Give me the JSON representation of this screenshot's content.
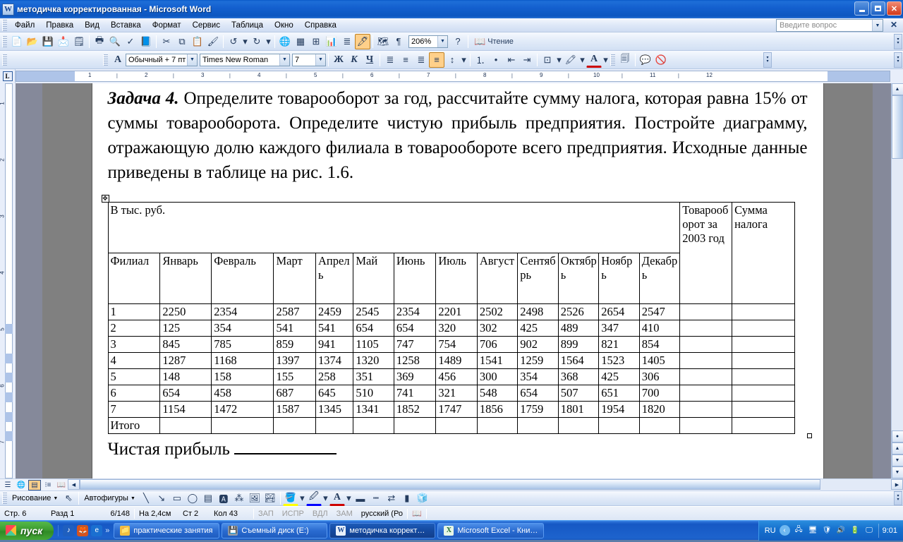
{
  "window": {
    "title": "методичка корректированная - Microsoft Word",
    "app_icon": "word-icon",
    "minimize": "minimize-icon",
    "maximize": "maximize-icon",
    "close": "✕"
  },
  "menu": {
    "items": [
      "Файл",
      "Правка",
      "Вид",
      "Вставка",
      "Формат",
      "Сервис",
      "Таблица",
      "Окно",
      "Справка"
    ]
  },
  "ask_box": {
    "placeholder": "Введите вопрос",
    "close": "✕"
  },
  "standard_toolbar": {
    "zoom_value": "206%",
    "reading_label": "Чтение",
    "buttons": [
      "new-document-icon",
      "open-folder-icon",
      "save-icon",
      "mail-icon",
      "permission-icon",
      "print-icon",
      "print-preview-icon",
      "spellcheck-icon",
      "research-icon",
      "cut-icon",
      "copy-icon",
      "paste-icon",
      "format-painter-icon",
      "undo-icon",
      "redo-icon",
      "insert-hyperlink-icon",
      "insert-table-icon",
      "tables-borders-icon",
      "insert-excel-sheet-icon",
      "columns-icon",
      "drawing-icon",
      "document-map-icon",
      "show-formatting-icon",
      "help-icon"
    ]
  },
  "formatting_toolbar": {
    "style": "Обычный + 7 пт",
    "font": "Times New Roman",
    "size": "7",
    "bold": "Ж",
    "italic": "К",
    "underline": "Ч",
    "buttons": [
      "styles-icon",
      "align-left-icon",
      "align-center-icon",
      "align-right-icon",
      "align-justify-icon",
      "line-spacing-icon",
      "numbered-list-icon",
      "bulleted-list-icon",
      "decrease-indent-icon",
      "increase-indent-icon",
      "borders-icon",
      "highlight-icon",
      "font-color-icon"
    ]
  },
  "ruler": {
    "tab_selector": "L",
    "h_numbers": [
      "1",
      "2",
      "3",
      "4",
      "5",
      "6",
      "7",
      "8",
      "9",
      "10",
      "11",
      "12"
    ],
    "v_numbers": [
      "1",
      "2",
      "3",
      "4",
      "5",
      "6",
      "7"
    ]
  },
  "document": {
    "paragraph": {
      "lead_bold": "Задача 4.",
      "text": " Определите товарооборот за год, рассчитайте сумму налога, которая равна 15% от суммы товарооборота. Определите чистую прибыль предприятия. Постройте диаграмму, отражающую долю каждого филиала в товарообороте всего предприятия. Исходные данные приведены в таблице на рис. 1.6."
    },
    "table": {
      "caption": "В тыс. руб.",
      "headers": [
        "Филиал",
        "Январь",
        "Февраль",
        "Март",
        "Апрель",
        "Май",
        "Июнь",
        "Июль",
        "Август",
        "Сентябрь",
        "Октябрь",
        "Ноябрь",
        "Декабрь"
      ],
      "summary_headers": [
        "Товарооборот за 2003 год",
        "Сумма налога"
      ],
      "rows": [
        {
          "branch": "1",
          "values": [
            "2250",
            "2354",
            "2587",
            "2459",
            "2545",
            "2354",
            "2201",
            "2502",
            "2498",
            "2526",
            "2654",
            "2547"
          ],
          "turnover": "",
          "tax": ""
        },
        {
          "branch": "2",
          "values": [
            "125",
            "354",
            "541",
            "541",
            "654",
            "654",
            "320",
            "302",
            "425",
            "489",
            "347",
            "410"
          ],
          "turnover": "",
          "tax": ""
        },
        {
          "branch": "3",
          "values": [
            "845",
            "785",
            "859",
            "941",
            "1105",
            "747",
            "754",
            "706",
            "902",
            "899",
            "821",
            "854"
          ],
          "turnover": "",
          "tax": ""
        },
        {
          "branch": "4",
          "values": [
            "1287",
            "1168",
            "1397",
            "1374",
            "1320",
            "1258",
            "1489",
            "1541",
            "1259",
            "1564",
            "1523",
            "1405"
          ],
          "turnover": "",
          "tax": ""
        },
        {
          "branch": "5",
          "values": [
            "148",
            "158",
            "155",
            "258",
            "351",
            "369",
            "456",
            "300",
            "354",
            "368",
            "425",
            "306"
          ],
          "turnover": "",
          "tax": ""
        },
        {
          "branch": "6",
          "values": [
            "654",
            "458",
            "687",
            "645",
            "510",
            "741",
            "321",
            "548",
            "654",
            "507",
            "651",
            "700"
          ],
          "turnover": "",
          "tax": ""
        },
        {
          "branch": "7",
          "values": [
            "1154",
            "1472",
            "1587",
            "1345",
            "1341",
            "1852",
            "1747",
            "1856",
            "1759",
            "1801",
            "1954",
            "1820"
          ],
          "turnover": "",
          "tax": ""
        },
        {
          "branch": "Итого",
          "values": [
            "",
            "",
            "",
            "",
            "",
            "",
            "",
            "",
            "",
            "",
            "",
            ""
          ],
          "turnover": "",
          "tax": ""
        }
      ]
    },
    "footer_text": "Чистая прибыль"
  },
  "drawing_toolbar": {
    "draw_label": "Рисование",
    "autoshapes_label": "Автофигуры",
    "buttons": [
      "select-objects-icon",
      "line-icon",
      "arrow-icon",
      "rectangle-icon",
      "oval-icon",
      "text-box-icon",
      "wordart-icon",
      "diagram-icon",
      "clipart-icon",
      "picture-icon",
      "fill-color-icon",
      "line-color-icon",
      "font-color-icon",
      "line-style-icon",
      "dash-style-icon",
      "arrow-style-icon",
      "shadow-style-icon",
      "3d-style-icon"
    ]
  },
  "status_bar": {
    "page": "Стр. 6",
    "section": "Разд 1",
    "page_of": "6/148",
    "at": "На 2,4см",
    "line": "Ст 2",
    "column": "Кол 43",
    "modes": [
      "ЗАП",
      "ИСПР",
      "ВДЛ",
      "ЗАМ"
    ],
    "language": "русский (Ро",
    "spell_icon": "spellcheck-status-icon"
  },
  "view_buttons": [
    "normal-view-icon",
    "web-layout-icon",
    "print-layout-icon",
    "outline-view-icon",
    "reading-layout-icon"
  ],
  "taskbar": {
    "start_label": "пуск",
    "quick_launch": [
      "media-player-icon",
      "firefox-icon",
      "internet-explorer-icon",
      "more-icon"
    ],
    "tasks": [
      {
        "label": "практические занятия",
        "icon": "folder-icon"
      },
      {
        "label": "Съемный диск (E:)",
        "icon": "removable-disk-icon"
      },
      {
        "label": "методичка коррект…",
        "icon": "word-icon"
      },
      {
        "label": "Microsoft Excel - Кни…",
        "icon": "excel-icon"
      }
    ],
    "language_indicator": "RU",
    "tray_icons": [
      "show-hidden-icon",
      "network-icon",
      "network-disconnected-icon",
      "antivirus-icon",
      "volume-icon",
      "battery-icon",
      "monitor-icon"
    ],
    "clock": "9:01"
  },
  "colors": {
    "title_blue": "#1460cf",
    "taskbar_blue": "#1d63cd",
    "start_green": "#3c9c30",
    "toolbar_bg": "#e3ecf9",
    "page_bg": "#ffffff",
    "desk_gray": "#808080"
  }
}
